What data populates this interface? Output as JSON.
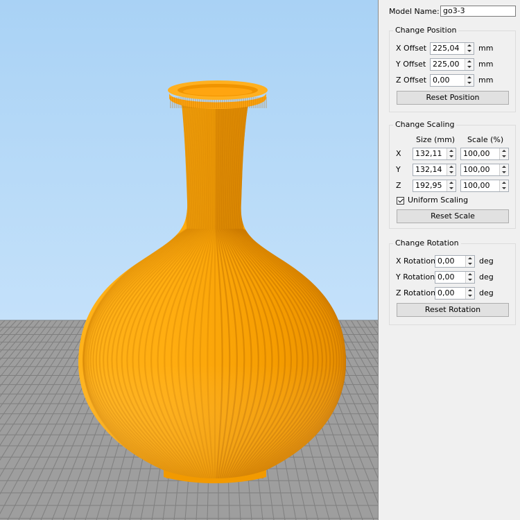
{
  "model_name": {
    "label": "Model Name:",
    "value": "go3-3"
  },
  "position": {
    "title": "Change Position",
    "rows": [
      {
        "label": "X Offset",
        "value": "225,04",
        "unit": "mm"
      },
      {
        "label": "Y Offset",
        "value": "225,00",
        "unit": "mm"
      },
      {
        "label": "Z Offset",
        "value": "0,00",
        "unit": "mm"
      }
    ],
    "reset_label": "Reset Position"
  },
  "scaling": {
    "title": "Change Scaling",
    "size_header": "Size (mm)",
    "scale_header": "Scale (%)",
    "rows": [
      {
        "axis": "X",
        "size": "132,11",
        "scale": "100,00"
      },
      {
        "axis": "Y",
        "size": "132,14",
        "scale": "100,00"
      },
      {
        "axis": "Z",
        "size": "192,95",
        "scale": "100,00"
      }
    ],
    "uniform_label": "Uniform Scaling",
    "uniform_checked": true,
    "reset_label": "Reset Scale"
  },
  "rotation": {
    "title": "Change Rotation",
    "rows": [
      {
        "label": "X Rotation",
        "value": "0,00",
        "unit": "deg"
      },
      {
        "label": "Y Rotation",
        "value": "0,00",
        "unit": "deg"
      },
      {
        "label": "Z Rotation",
        "value": "0,00",
        "unit": "deg"
      }
    ],
    "reset_label": "Reset Rotation"
  },
  "colors": {
    "sky_top": "#a9d2f5",
    "sky_bottom": "#c2e0fa",
    "floor": "#9d9d9d",
    "grid_line": "#7e7e7e",
    "model": "#ffa500",
    "model_dark": "#e08a00",
    "model_light": "#ffc040"
  },
  "viewport": {
    "icon": "vase-model"
  }
}
